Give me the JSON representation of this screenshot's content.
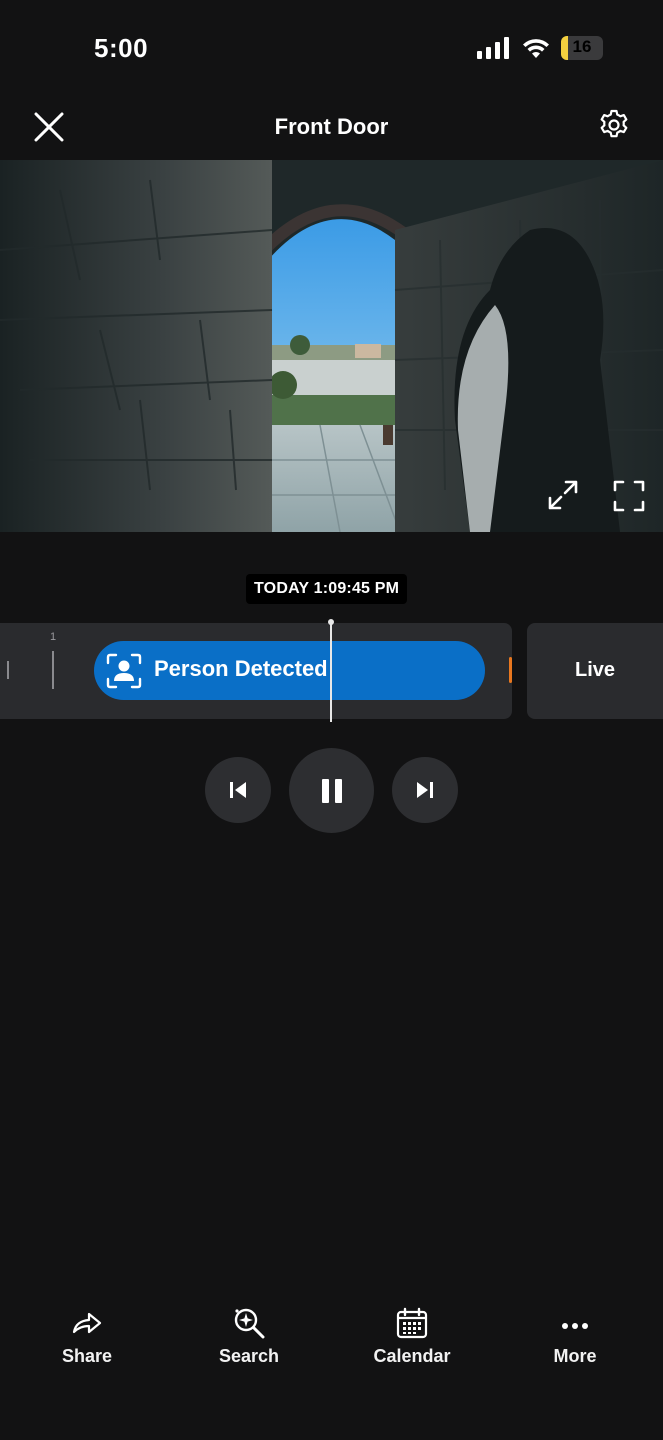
{
  "status_bar": {
    "time": "5:00",
    "battery_level": "16",
    "battery_fraction": 0.16,
    "icons": [
      "cellular-signal-icon",
      "wifi-icon",
      "battery-icon"
    ]
  },
  "header": {
    "title": "Front Door",
    "close_icon": "close-icon",
    "settings_icon": "gear-icon"
  },
  "video": {
    "controls": [
      "expand-icon",
      "fullscreen-icon"
    ]
  },
  "timeline": {
    "timestamp": "TODAY 1:09:45 PM",
    "tick_label": "1",
    "event_label": "Person Detected",
    "event_icon": "person-icon",
    "live_label": "Live"
  },
  "playback": {
    "controls": [
      "skip-previous-icon",
      "pause-icon",
      "skip-next-icon"
    ]
  },
  "bottom_nav": {
    "items": [
      {
        "label": "Share",
        "icon": "share-icon"
      },
      {
        "label": "Search",
        "icon": "search-sparkle-icon"
      },
      {
        "label": "Calendar",
        "icon": "calendar-icon"
      },
      {
        "label": "More",
        "icon": "more-icon"
      }
    ]
  },
  "colors": {
    "background": "#121213",
    "accent": "#0a6fc7",
    "panel": "#2a2b2e",
    "battery": "#f4d03f",
    "event_marker": "#e8771f"
  }
}
